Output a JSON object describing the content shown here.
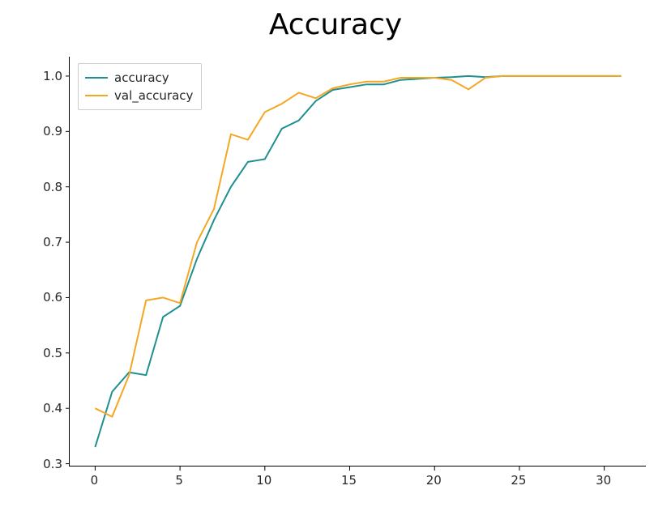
{
  "chart_data": {
    "type": "line",
    "title": "Accuracy",
    "xlabel": "",
    "ylabel": "",
    "xlim": [
      -1.5,
      32.5
    ],
    "ylim": [
      0.295,
      1.035
    ],
    "xticks": [
      0,
      5,
      10,
      15,
      20,
      25,
      30
    ],
    "yticks": [
      0.3,
      0.4,
      0.5,
      0.6,
      0.7,
      0.8,
      0.9,
      1.0
    ],
    "x": [
      0,
      1,
      2,
      3,
      4,
      5,
      6,
      7,
      8,
      9,
      10,
      11,
      12,
      13,
      14,
      15,
      16,
      17,
      18,
      19,
      20,
      21,
      22,
      23,
      24,
      25,
      26,
      27,
      28,
      29,
      30,
      31
    ],
    "series": [
      {
        "name": "accuracy",
        "color": "#1f8f8f",
        "values": [
          0.33,
          0.43,
          0.465,
          0.46,
          0.565,
          0.585,
          0.67,
          0.74,
          0.8,
          0.845,
          0.85,
          0.905,
          0.92,
          0.955,
          0.975,
          0.98,
          0.985,
          0.985,
          0.993,
          0.995,
          0.997,
          0.998,
          1.0,
          0.998,
          1.0,
          1.0,
          1.0,
          1.0,
          1.0,
          1.0,
          1.0,
          1.0
        ]
      },
      {
        "name": "val_accuracy",
        "color": "#f5a623",
        "values": [
          0.4,
          0.385,
          0.46,
          0.595,
          0.6,
          0.59,
          0.7,
          0.76,
          0.895,
          0.885,
          0.935,
          0.95,
          0.97,
          0.96,
          0.978,
          0.985,
          0.99,
          0.99,
          0.997,
          0.997,
          0.997,
          0.993,
          0.976,
          0.997,
          1.0,
          1.0,
          1.0,
          1.0,
          1.0,
          1.0,
          1.0,
          1.0
        ]
      }
    ],
    "legend_position": "upper left"
  }
}
